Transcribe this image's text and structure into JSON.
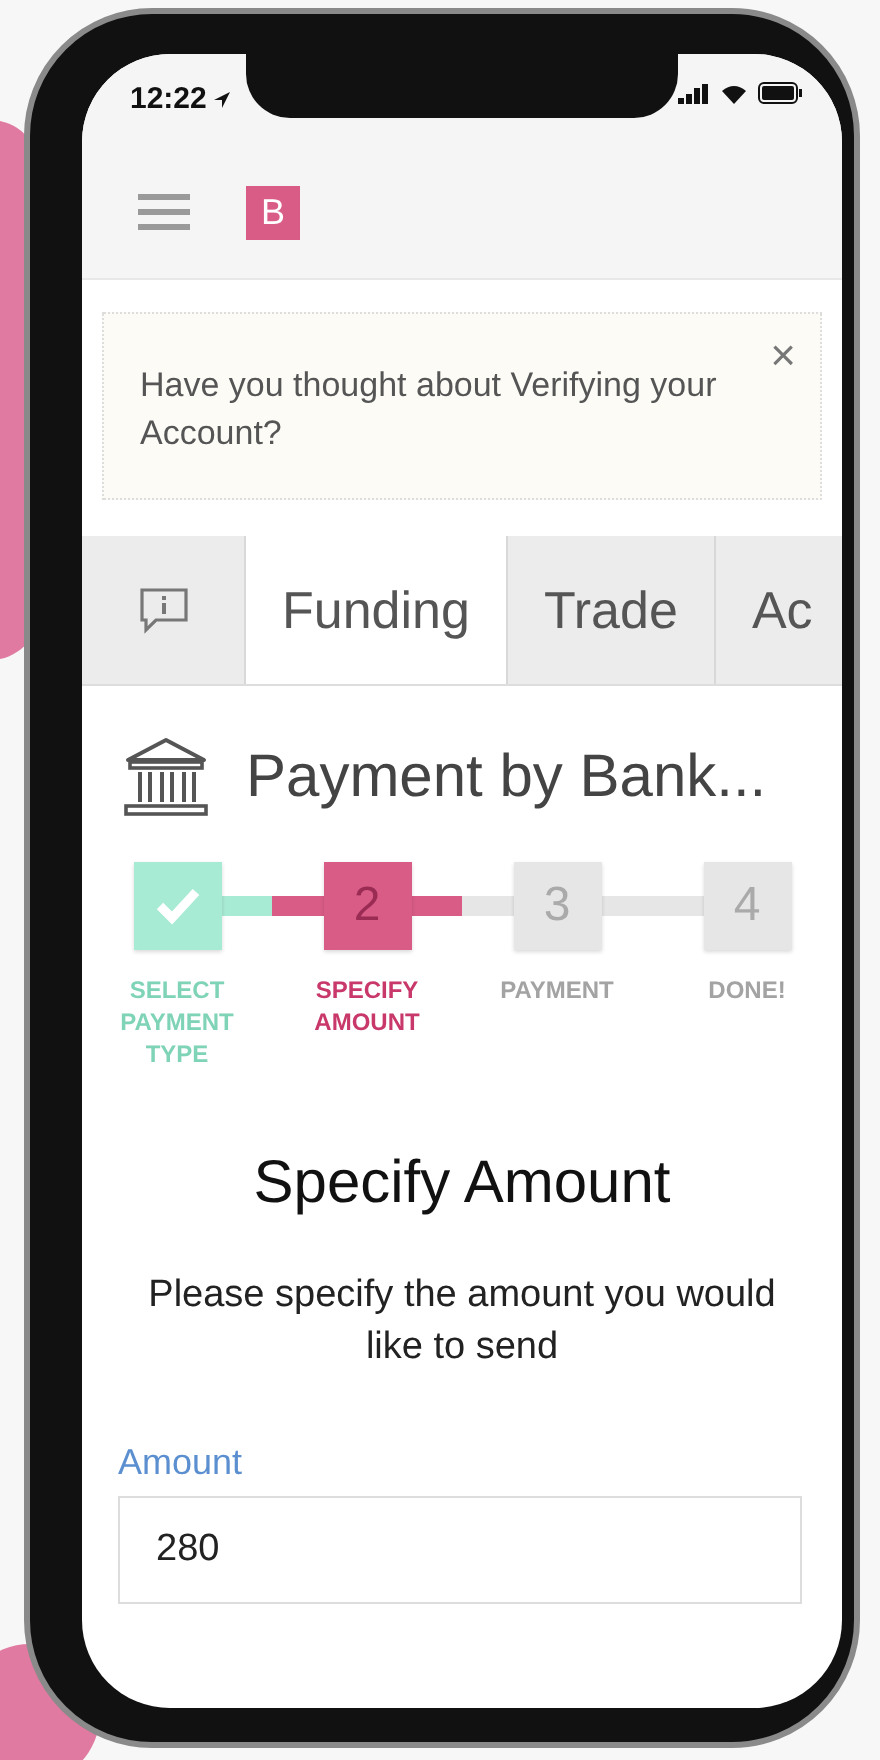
{
  "status_bar": {
    "time": "12:22"
  },
  "header": {
    "logo": "B"
  },
  "banner": {
    "text": "Have you thought about Verifying your Account?",
    "close": "×"
  },
  "tabs": [
    {
      "kind": "icon",
      "selected": false
    },
    {
      "kind": "text",
      "label": "Funding",
      "selected": true
    },
    {
      "kind": "text",
      "label": "Trade",
      "selected": false
    },
    {
      "kind": "text",
      "label": "Ac",
      "selected": false
    }
  ],
  "heading": "Payment by Bank...",
  "steps": [
    {
      "label": "SELECT PAYMENT TYPE",
      "done": true,
      "current": false
    },
    {
      "number": "2",
      "label": "SPECIFY AMOUNT",
      "done": false,
      "current": true
    },
    {
      "number": "3",
      "label": "PAYMENT",
      "done": false,
      "current": false
    },
    {
      "number": "4",
      "label": "DONE!",
      "done": false,
      "current": false
    }
  ],
  "section_title": "Specify Amount",
  "instruction": "Please specify the amount you would like to send",
  "amount_field": {
    "label": "Amount",
    "value": "280"
  }
}
